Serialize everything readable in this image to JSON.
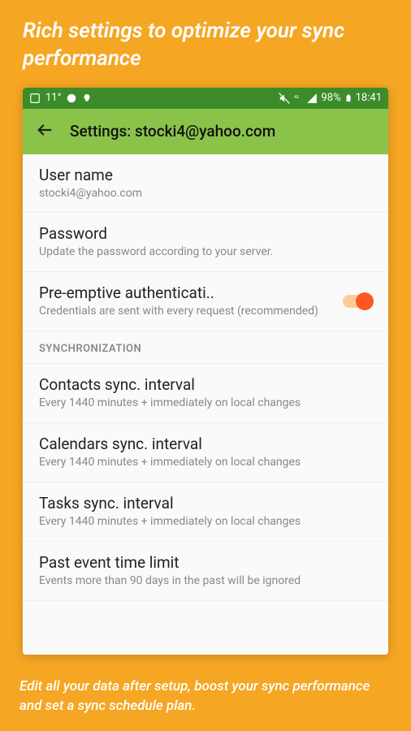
{
  "promo": {
    "header": "Rich settings to optimize your sync performance",
    "footer": "Edit all your data after setup, boost your sync performance and set a sync schedule plan."
  },
  "statusBar": {
    "temp": "11°",
    "battery": "98%",
    "time": "18:41"
  },
  "appBar": {
    "title": "Settings: stocki4@yahoo.com"
  },
  "settings": {
    "username": {
      "title": "User name",
      "value": "stocki4@yahoo.com"
    },
    "password": {
      "title": "Password",
      "sub": "Update the password according to your server."
    },
    "preemptive": {
      "title": "Pre-emptive authenticati..",
      "sub": "Credentials are sent with every request (recommended)"
    },
    "sectionSync": "SYNCHRONIZATION",
    "contacts": {
      "title": "Contacts sync. interval",
      "sub": "Every 1440 minutes + immediately on local changes"
    },
    "calendars": {
      "title": "Calendars sync. interval",
      "sub": "Every 1440 minutes + immediately on local changes"
    },
    "tasks": {
      "title": "Tasks sync. interval",
      "sub": "Every 1440 minutes + immediately on local changes"
    },
    "pastEvent": {
      "title": "Past event time limit",
      "sub": "Events more than 90 days in the past will be ignored"
    }
  }
}
